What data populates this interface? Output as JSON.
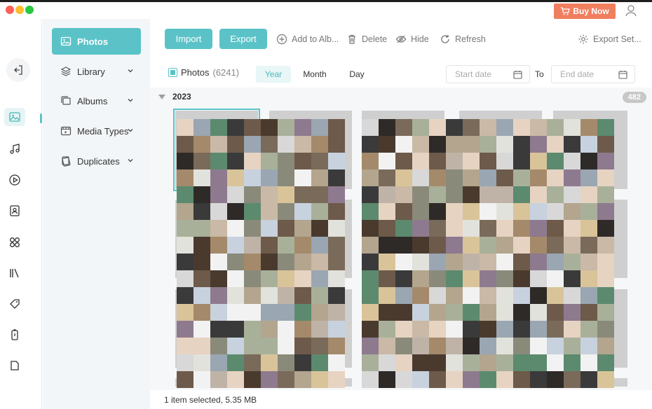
{
  "window": {
    "buy_now_label": "Buy Now",
    "traffic_colors": [
      "#fe5f57",
      "#febc2e",
      "#28c840"
    ]
  },
  "rail": {
    "items": [
      {
        "name": "back-icon"
      },
      {
        "name": "photos-icon",
        "active": true
      },
      {
        "name": "music-icon"
      },
      {
        "name": "video-icon"
      },
      {
        "name": "contacts-icon"
      },
      {
        "name": "apps-icon"
      },
      {
        "name": "books-icon"
      },
      {
        "name": "tag-icon"
      },
      {
        "name": "battery-icon"
      },
      {
        "name": "file-icon"
      }
    ]
  },
  "sidebar": {
    "items": [
      {
        "label": "Photos",
        "icon": "photo-icon",
        "active": true
      },
      {
        "label": "Library",
        "icon": "layers-icon"
      },
      {
        "label": "Albums",
        "icon": "albums-icon"
      },
      {
        "label": "Media Types",
        "icon": "media-icon"
      },
      {
        "label": "Duplicates",
        "icon": "duplicates-icon"
      }
    ]
  },
  "toolbar": {
    "import_label": "Import",
    "export_label": "Export",
    "add_to_album_label": "Add to Alb...",
    "delete_label": "Delete",
    "hide_label": "Hide",
    "refresh_label": "Refresh",
    "export_settings_label": "Export Set..."
  },
  "filter": {
    "photos_label": "Photos",
    "photos_count": "(6241)",
    "year_label": "Year",
    "month_label": "Month",
    "day_label": "Day",
    "start_placeholder": "Start date",
    "to_label": "To",
    "end_placeholder": "End date"
  },
  "gallery": {
    "year": "2023",
    "count_badge": "482"
  },
  "status": {
    "text": "1 item selected, 5.35 MB"
  },
  "colors": {
    "accent": "#5bc3c7",
    "buy_now": "#f07f5f"
  }
}
